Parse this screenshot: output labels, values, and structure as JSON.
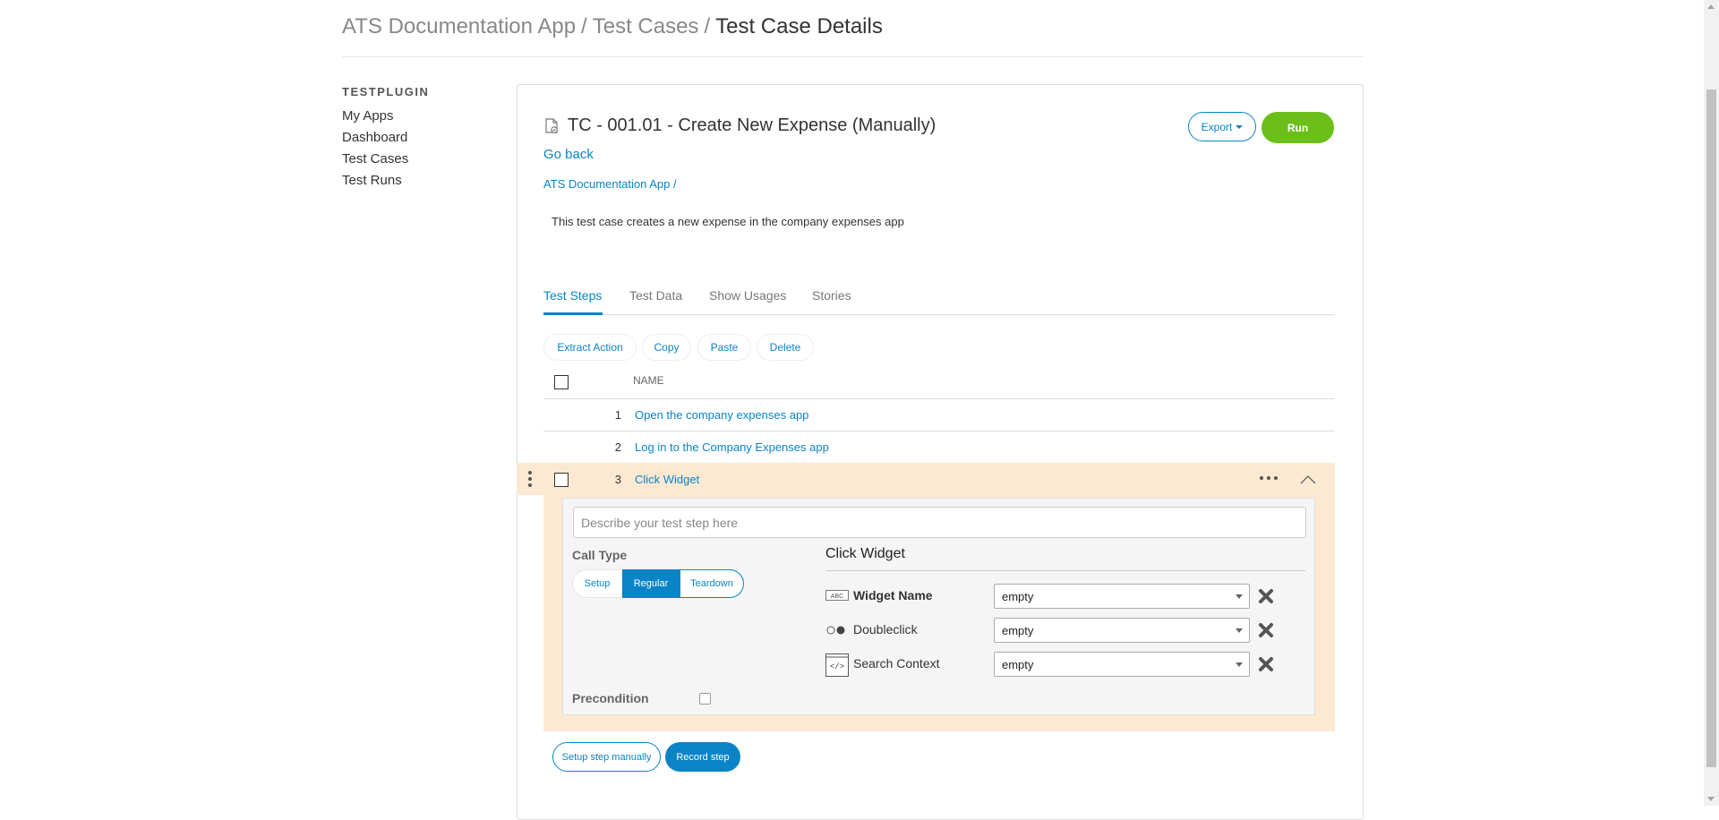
{
  "breadcrumb": {
    "items": [
      "ATS Documentation App",
      "Test Cases",
      "Test Case Details"
    ],
    "separator": "/"
  },
  "sidebar": {
    "title": "TESTPLUGIN",
    "items": [
      "My Apps",
      "Dashboard",
      "Test Cases",
      "Test Runs"
    ]
  },
  "testcase": {
    "title": "TC - 001.01 - Create New Expense (Manually)",
    "go_back": "Go back",
    "app_link": "ATS Documentation App /",
    "description": "This test case creates a new expense in the company expenses app",
    "export_label": "Export",
    "run_label": "Run"
  },
  "tabs": [
    {
      "label": "Test Steps",
      "active": true
    },
    {
      "label": "Test Data",
      "active": false
    },
    {
      "label": "Show Usages",
      "active": false
    },
    {
      "label": "Stories",
      "active": false
    }
  ],
  "actions": [
    "Extract Action",
    "Copy",
    "Paste",
    "Delete"
  ],
  "table": {
    "column_name": "NAME",
    "rows": [
      {
        "num": "1",
        "name": "Open the company expenses app"
      },
      {
        "num": "2",
        "name": "Log in to the Company Expenses app"
      },
      {
        "num": "3",
        "name": "Click Widget",
        "expanded": true
      }
    ]
  },
  "step_editor": {
    "description_placeholder": "Describe your test step here",
    "call_type_label": "Call Type",
    "call_types": [
      "Setup",
      "Regular",
      "Teardown"
    ],
    "selected_call_type": "Regular",
    "action_title": "Click Widget",
    "params": [
      {
        "name": "Widget Name",
        "value": "empty",
        "icon": "text-abc-icon",
        "bold": true
      },
      {
        "name": "Doubleclick",
        "value": "empty",
        "icon": "boolean-radio-icon",
        "bold": false
      },
      {
        "name": "Search Context",
        "value": "empty",
        "icon": "code-context-icon",
        "bold": false
      }
    ],
    "precondition_label": "Precondition",
    "precondition_checked": false
  },
  "bottom_buttons": {
    "setup_manually": "Setup step manually",
    "record": "Record step"
  },
  "colors": {
    "accent": "#0a84c6",
    "run": "#6bbf19",
    "expanded_row": "#fde9d2"
  }
}
